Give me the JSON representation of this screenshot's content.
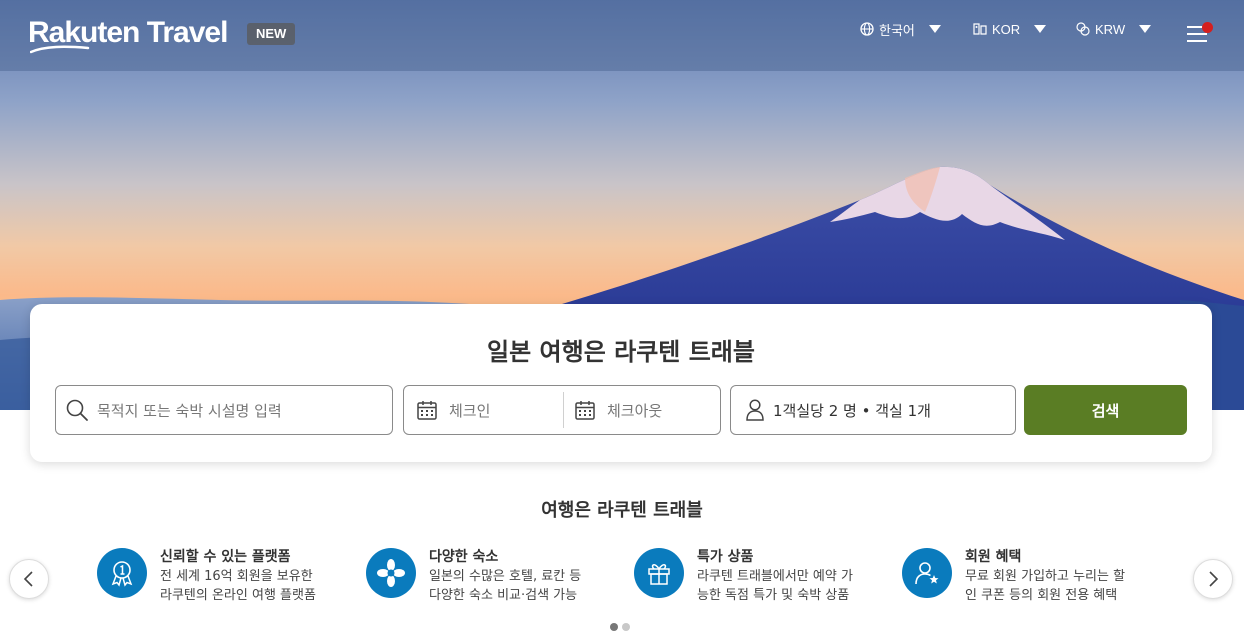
{
  "header": {
    "logo": "Rakuten Travel",
    "badge": "NEW",
    "language": "한국어",
    "region": "KOR",
    "currency": "KRW",
    "notification_color": "#d41f1f"
  },
  "search": {
    "title": "일본 여행은 라쿠텐 트래블",
    "destination_placeholder": "목적지 또는 숙박 시설명 입력",
    "checkin_placeholder": "체크인",
    "checkout_placeholder": "체크아웃",
    "guests_value": "1객실당 2 명 • 객실 1개",
    "search_button": "검색",
    "accent_color": "#5a7d24"
  },
  "features": {
    "title": "여행은 라쿠텐 트래블",
    "icon_color": "#0a7bbd",
    "items": [
      {
        "title": "신뢰할 수 있는 플랫폼",
        "desc_1": "전 세계 16억 회원을 보유한",
        "desc_2": "라쿠텐의 온라인 여행 플랫폼",
        "icon": "award-medal-icon"
      },
      {
        "title": "다양한 숙소",
        "desc_1": "일본의 수많은 호텔, 료칸 등",
        "desc_2": "다양한 숙소 비교·검색 가능",
        "icon": "flower-icon"
      },
      {
        "title": "특가 상품",
        "desc_1": "라쿠텐 트래블에서만 예약 가",
        "desc_2": "능한 독점 특가 및 숙박 상품",
        "icon": "gift-icon"
      },
      {
        "title": "회원 혜택",
        "desc_1": "무료 회원 가입하고 누리는 할",
        "desc_2": "인 쿠폰 등의 회원 전용 혜택",
        "icon": "member-star-icon"
      }
    ],
    "carousel_page": 1,
    "carousel_pages": 2
  }
}
